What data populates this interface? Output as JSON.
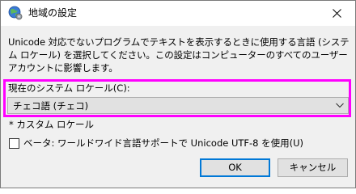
{
  "window": {
    "title": "地域の設定",
    "icon": "globe-settings-icon",
    "close_icon": "close-icon"
  },
  "description": "Unicode 対応でないプログラムでテキストを表示するときに使用する言語 (システム ロケール) を選択してください。この設定はコンピューターのすべてのユーザー アカウントに影響します。",
  "system_locale": {
    "label": "現在のシステム ロケール(C):",
    "selected": "チェコ語 (チェコ)",
    "dropdown_icon": "chevron-down-icon"
  },
  "custom_note": "* カスタム ロケール",
  "beta_utf8": {
    "label": "ベータ: ワールドワイド言語サポートで Unicode UTF-8 を使用(U)",
    "checked": false
  },
  "buttons": {
    "ok": "OK",
    "cancel": "キャンセル"
  },
  "colors": {
    "highlight": "#ff00ff",
    "default_button_border": "#0078d7"
  }
}
